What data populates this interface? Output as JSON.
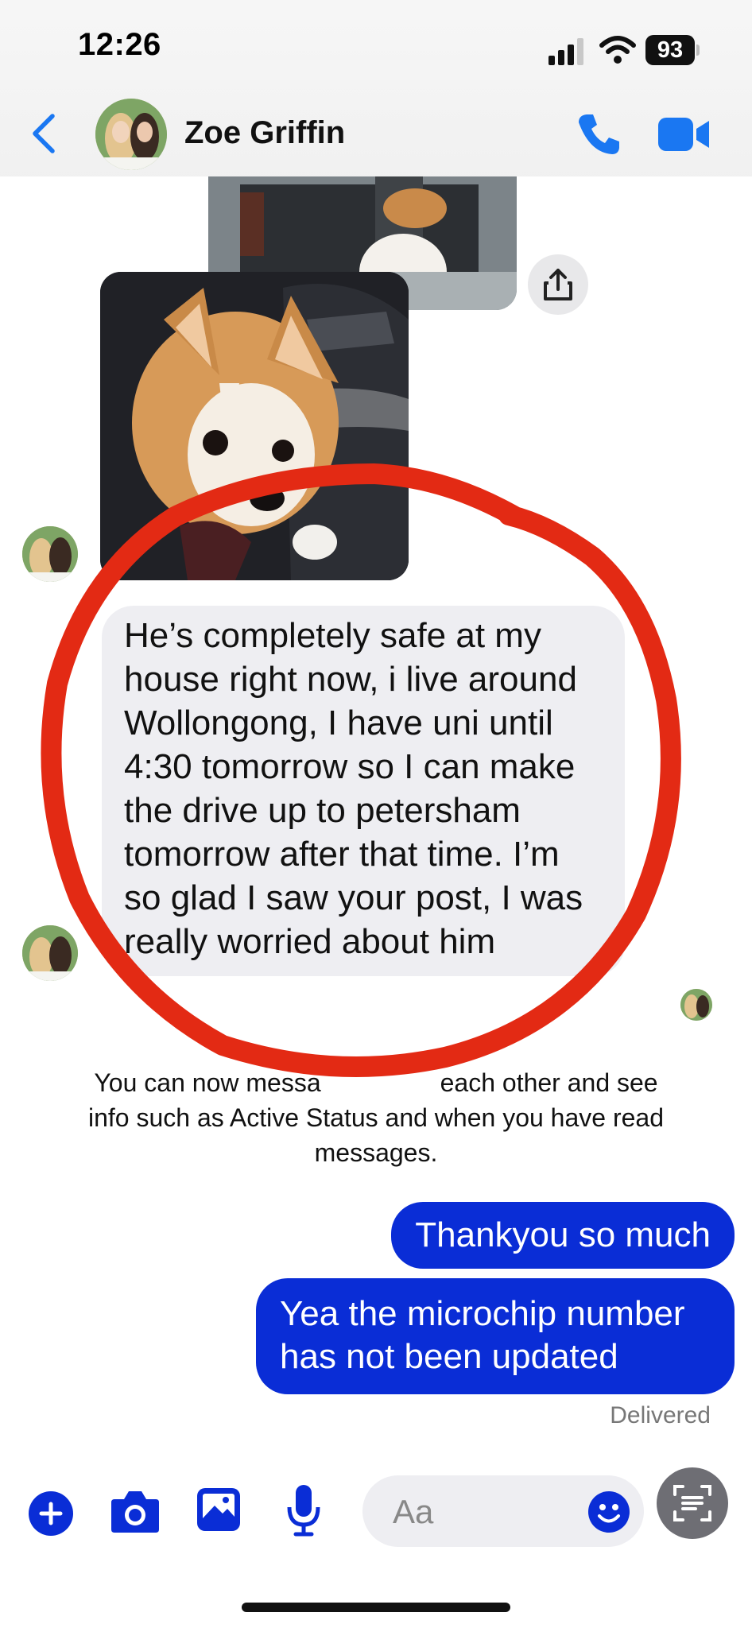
{
  "status_bar": {
    "time": "12:26",
    "battery": "93"
  },
  "header": {
    "contact_name": "Zoe Griffin"
  },
  "messages": {
    "incoming_text": "He’s completely safe at my house right now, i live around Wollongong, I have uni until 4:30 tomorrow so I can make the drive up to petersham tomorrow after that time. I’m so glad I saw your post, I was really worried about him",
    "incoming_lines": [
      "He’s completely safe at my",
      "house right now, i live around",
      "Wollongong, I have uni until",
      "4:30 tomorrow so I can make",
      "the drive up to petersham",
      "tomorrow after that time. I’m",
      "so glad I saw your post, I was",
      "really worried about him"
    ],
    "notice_line1": "You can now messa",
    "notice_line1b": "each other and see",
    "notice_line2": "info such as Active Status and when you have read",
    "notice_line3": "messages.",
    "outgoing": [
      {
        "text": "Thankyou so much"
      },
      {
        "text_line1": "Yea the microchip number",
        "text_line2": "has not been updated"
      }
    ],
    "delivered": "Delivered"
  },
  "composer": {
    "placeholder": "Aa"
  },
  "colors": {
    "accent": "#0a2dd6",
    "header_icon": "#1a77f2",
    "annotation": "#e32a14"
  },
  "icons": [
    "back-chevron-icon",
    "phone-icon",
    "video-camera-icon",
    "share-icon",
    "plus-icon",
    "camera-icon",
    "image-icon",
    "microphone-icon",
    "emoji-icon",
    "scan-text-icon",
    "signal-icon",
    "wifi-icon"
  ]
}
